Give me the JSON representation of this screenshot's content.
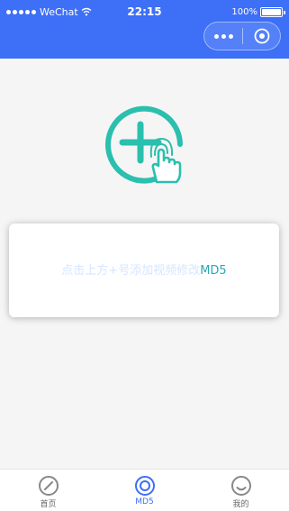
{
  "status_bar": {
    "carrier": "WeChat",
    "time": "22:15",
    "battery": "100%"
  },
  "capsule": {
    "more_icon": "more-dots-icon",
    "close_icon": "target-circle-icon"
  },
  "main": {
    "add_icon": "add-video-tap-icon",
    "hint_text": "点击上方+号添加视频修改",
    "hint_suffix": "MD5",
    "accent_color": "#2abfae"
  },
  "tabbar": {
    "items": [
      {
        "label": "首页",
        "icon": "compass-icon",
        "active": false
      },
      {
        "label": "MD5",
        "icon": "md5-target-icon",
        "active": true
      },
      {
        "label": "我的",
        "icon": "smile-face-icon",
        "active": false
      }
    ],
    "active_color": "#3d6ff7",
    "inactive_color": "#888888"
  },
  "colors": {
    "header": "#3d6ff7",
    "background": "#f5f5f5"
  }
}
